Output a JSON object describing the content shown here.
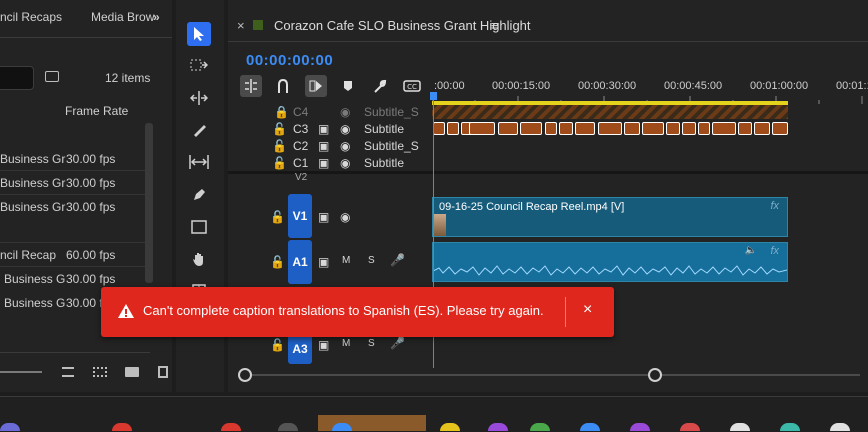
{
  "project": {
    "tabs": [
      "ncil Recaps",
      "Media Brow"
    ],
    "tab_more": "»",
    "items_count": "12 items",
    "col_frame_rate": "Frame Rate",
    "rows": [
      {
        "name": "Business Gr",
        "rate": "30.00 fps"
      },
      {
        "name": "Business Gr",
        "rate": "30.00 fps"
      },
      {
        "name": "Business Gr",
        "rate": "30.00 fps"
      },
      {
        "name": "ncil Recap",
        "rate": "60.00 fps"
      },
      {
        "name": "Business G",
        "rate": "30.00 fps"
      },
      {
        "name": "Business G",
        "rate": "30.00 fps"
      }
    ]
  },
  "timeline": {
    "close": "×",
    "title": "Corazon Cafe SLO Business Grant Highlight",
    "menu": "≡",
    "timecode": "00:00:00:00",
    "ruler": [
      ":00:00",
      "00:00:15:00",
      "00:00:30:00",
      "00:00:45:00",
      "00:01:00:00",
      "00:01:1"
    ],
    "caption_tracks": [
      {
        "id": "C4",
        "name": "Subtitle_S"
      },
      {
        "id": "C3",
        "name": "Subtitle"
      },
      {
        "id": "C2",
        "name": "Subtitle_S"
      },
      {
        "id": "C1",
        "name": "Subtitle"
      }
    ],
    "v2": "V2",
    "v1": "V1",
    "a1": "A1",
    "a3": "A3",
    "m": "M",
    "s": "S",
    "video_clip": "09-16-25 Council Recap Reel.mp4 [V]",
    "fx": "fx"
  },
  "toast": {
    "message": "Can't complete caption translations to Spanish (ES). Please try again.",
    "close": "×"
  },
  "colors": {
    "accent": "#3b8cf5",
    "error": "#e0271d",
    "caption_clip": "#a04c1a",
    "video_clip": "#165b7a",
    "audio_clip": "#166e9a"
  }
}
